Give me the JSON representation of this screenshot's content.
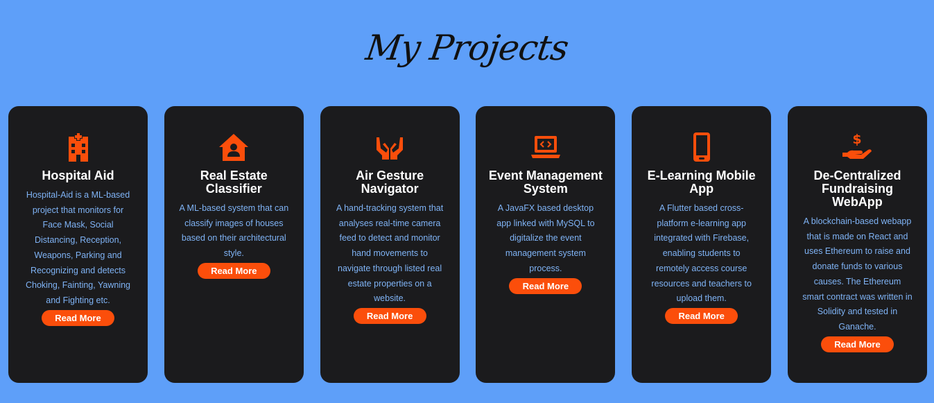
{
  "page": {
    "title": "My Projects",
    "accent_color": "#fb4e0b",
    "background_color": "#5e9ff9",
    "card_color": "#1b1b1d"
  },
  "projects": [
    {
      "icon": "hospital-icon",
      "title": "Hospital Aid",
      "description": "Hospital-Aid is a ML-based project that monitors for Face Mask, Social Distancing, Reception, Weapons, Parking and Recognizing and detects Choking, Fainting, Yawning and Fighting etc.",
      "button_label": "Read More"
    },
    {
      "icon": "house-user-icon",
      "title": "Real Estate Classifier",
      "description": "A ML-based system that can classify images of houses based on their architectural style.",
      "button_label": "Read More"
    },
    {
      "icon": "hands-icon",
      "title": "Air Gesture Navigator",
      "description": "A hand-tracking system that analyses real-time camera feed to detect and monitor hand movements to navigate through listed real estate properties on a website.",
      "button_label": "Read More"
    },
    {
      "icon": "laptop-code-icon",
      "title": "Event Management System",
      "description": "A JavaFX based desktop app linked with MySQL to digitalize the event management system process.",
      "button_label": "Read More"
    },
    {
      "icon": "mobile-icon",
      "title": "E-Learning Mobile App",
      "description": "A Flutter based cross-platform e-learning app integrated with Firebase, enabling students to remotely access course resources and teachers to upload them.",
      "button_label": "Read More"
    },
    {
      "icon": "hand-holding-dollar-icon",
      "title": "De-Centralized Fundraising WebApp",
      "description": "A blockchain-based webapp that is made on React and uses Ethereum to raise and donate funds to various causes. The Ethereum smart contract was written in Solidity and tested in Ganache.",
      "button_label": "Read More"
    }
  ]
}
